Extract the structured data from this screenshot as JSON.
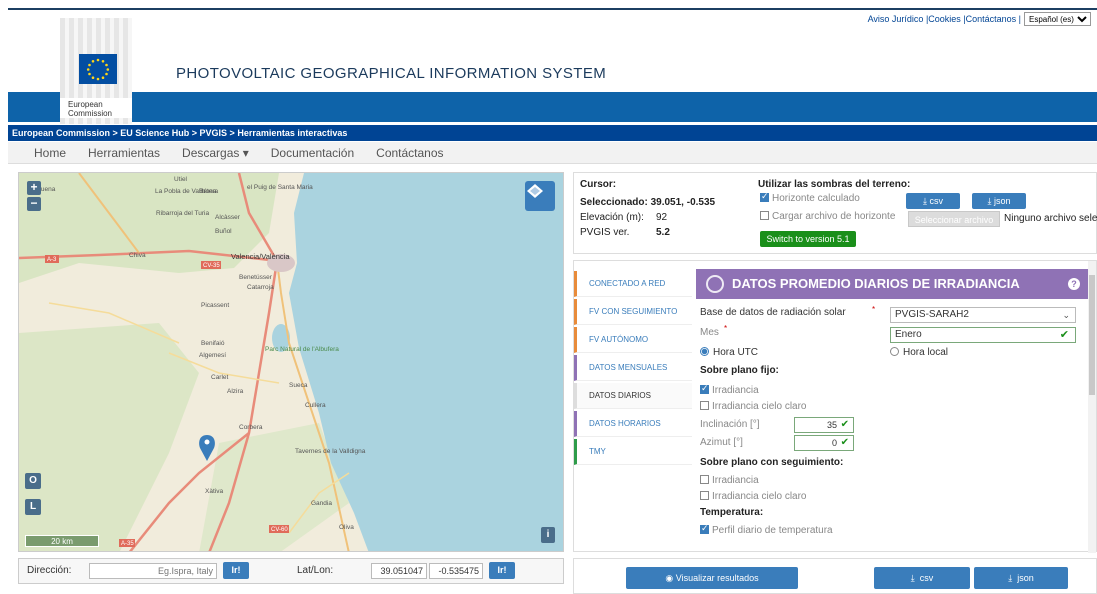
{
  "header": {
    "top_links": "Aviso Jurídico |Cookies |Contáctanos |",
    "language": "Español (es)",
    "logo_text_1": "European",
    "logo_text_2": "Commission",
    "site_title": "PHOTOVOLTAIC GEOGRAPHICAL INFORMATION SYSTEM"
  },
  "breadcrumb": "European Commission > EU Science Hub > PVGIS > Herramientas interactivas",
  "nav": [
    "Home",
    "Herramientas",
    "Descargas ▾",
    "Documentación",
    "Contáctanos"
  ],
  "map": {
    "labels": [
      "Utiel",
      "La Pobla de Vallbona",
      "Bétera",
      "el Puig de Santa Maria",
      "Ribarroja del Turia",
      "Alcàsser",
      "Buñol",
      "Chiva",
      "Valencia/València",
      "Benetússer",
      "Catarroja",
      "Picassent",
      "Benifaió",
      "Algemesí",
      "Carlet",
      "Alzira",
      "Sueca",
      "Cullera",
      "Parc Natural de l'Albufera",
      "Corbera",
      "Tavernes de la Valldigna",
      "Xàtiva",
      "Gandia",
      "Oliva",
      "Requena"
    ],
    "road_labels": [
      "A-3",
      "CV-35",
      "CV-60",
      "A-35"
    ],
    "scale": "20 km",
    "controls": {
      "zoom_in": "+",
      "zoom_out": "−",
      "o": "O",
      "l": "L",
      "i": "i"
    }
  },
  "address": {
    "label": "Dirección:",
    "placeholder": "Eg.Ispra, Italy",
    "go": "Ir!",
    "latlon_label": "Lat/Lon:",
    "lat": "39.051047",
    "lon": "-0.535475"
  },
  "info": {
    "cursor_label": "Cursor:",
    "selected_label": "Seleccionado:",
    "selected_value": "39.051, -0.535",
    "elevation_label": "Elevación (m):",
    "elevation_value": "92",
    "version_label": "PVGIS ver.",
    "version_value": "5.2",
    "shadows_title": "Utilizar las sombras del terreno:",
    "calc_horizon": "Horizonte calculado",
    "load_horizon": "Cargar archivo de horizonte",
    "csv": "csv",
    "json": "json",
    "select_file": "Seleccionar archivo",
    "no_file": "Ninguno archivo selec.",
    "switch": "Switch to version 5.1"
  },
  "tabs": [
    {
      "label": "CONECTADO A RED",
      "color": "#e88b3a"
    },
    {
      "label": "FV CON SEGUIMIENTO",
      "color": "#e88b3a"
    },
    {
      "label": "FV AUTÓNOMO",
      "color": "#e88b3a"
    },
    {
      "label": "DATOS MENSUALES",
      "color": "#8f72b5"
    },
    {
      "label": "DATOS DIARIOS",
      "color": "#dddddd"
    },
    {
      "label": "DATOS HORARIOS",
      "color": "#8f72b5"
    },
    {
      "label": "TMY",
      "color": "#2e9c4a"
    }
  ],
  "form": {
    "title": "DATOS PROMEDIO DIARIOS DE IRRADIANCIA",
    "db_label": "Base de datos de radiación solar",
    "db_value": "PVGIS-SARAH2",
    "month_label": "Mes",
    "month_value": "Enero",
    "utc": "Hora UTC",
    "local": "Hora local",
    "fixed_title": "Sobre plano fijo:",
    "irradiance": "Irradiancia",
    "clear_sky": "Irradiancia cielo claro",
    "slope_label": "Inclinación [°]",
    "slope_value": "35",
    "azimuth_label": "Azimut [°]",
    "azimuth_value": "0",
    "tracking_title": "Sobre plano con seguimiento:",
    "irradiance2": "Irradiancia",
    "clear_sky2": "Irradiancia cielo claro",
    "temp_title": "Temperatura:",
    "temp_profile": "Perfil diario de temperatura"
  },
  "bottom": {
    "visualize": "Visualizar resultados",
    "csv": "csv",
    "json": "json"
  }
}
